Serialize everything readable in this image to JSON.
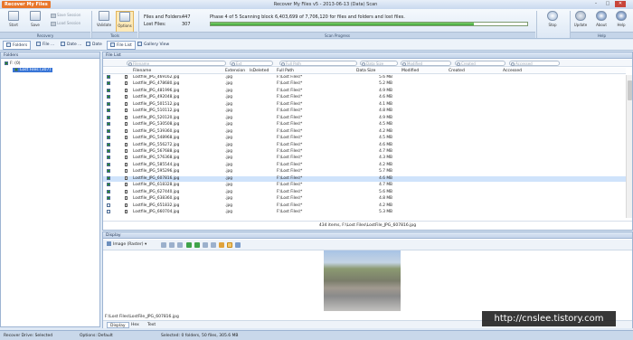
{
  "app": {
    "badge": "Recover My Files",
    "title": "Recover My Files v5 - 2013-06-13 (Data) Scan Results"
  },
  "window": {
    "minimize": "–",
    "maximize": "□",
    "close": "✕"
  },
  "ribbon": {
    "start": "Start",
    "save": "Save",
    "save_session": "Save Session",
    "load_session": "Load Session",
    "validate": "Validate",
    "options": "Options",
    "group_recovery": "Recovery",
    "group_tools": "Tools",
    "group_scan": "Scan Progress",
    "group_help": "Help",
    "files_folders_label": "Files and Folders:",
    "files_folders_value": "447",
    "lost_files_label": "Lost Files:",
    "lost_files_value": "307",
    "phase_text": "Phase 4 of 5 Scanning block 6,403,699 of 7,706,120 for files and folders and lost files.",
    "progress": 0.83,
    "stop": "Stop",
    "update": "Update",
    "about": "About",
    "help": "Help"
  },
  "viewtabs": [
    "Folders",
    "File ...",
    "Date ...",
    "Date",
    "File List",
    "Gallery View"
  ],
  "folders": {
    "header": "Folders",
    "root": "F: (0)",
    "child": "Lost Files (307)"
  },
  "filelist": {
    "header": "File List",
    "filters": [
      "Filename",
      "Ext",
      "Full Path",
      "Data Size",
      "Modified",
      "Created",
      "Accessed"
    ],
    "columns": [
      "Filename",
      "Extension",
      "IsDeleted",
      "Full Path",
      "Data Size",
      "Modified",
      "Created",
      "Accessed"
    ],
    "rows": [
      {
        "name": "Lostfile_JPG_469162.jpg",
        "ext": ".jpg",
        "path": "F:\\Lost Files\\*",
        "size": "5.6 MB",
        "checked": true
      },
      {
        "name": "Lostfile_JPG_478680.jpg",
        "ext": ".jpg",
        "path": "F:\\Lost Files\\*",
        "size": "5.2 MB",
        "checked": true
      },
      {
        "name": "Lostfile_JPG_481996.jpg",
        "ext": ".jpg",
        "path": "F:\\Lost Files\\*",
        "size": "4.9 MB",
        "checked": true
      },
      {
        "name": "Lostfile_JPG_492048.jpg",
        "ext": ".jpg",
        "path": "F:\\Lost Files\\*",
        "size": "4.6 MB",
        "checked": true
      },
      {
        "name": "Lostfile_JPG_501512.jpg",
        "ext": ".jpg",
        "path": "F:\\Lost Files\\*",
        "size": "4.1 MB",
        "checked": true
      },
      {
        "name": "Lostfile_JPG_510112.jpg",
        "ext": ".jpg",
        "path": "F:\\Lost Files\\*",
        "size": "4.8 MB",
        "checked": true
      },
      {
        "name": "Lostfile_JPG_520120.jpg",
        "ext": ".jpg",
        "path": "F:\\Lost Files\\*",
        "size": "4.9 MB",
        "checked": true
      },
      {
        "name": "Lostfile_JPG_530508.jpg",
        "ext": ".jpg",
        "path": "F:\\Lost Files\\*",
        "size": "4.5 MB",
        "checked": true
      },
      {
        "name": "Lostfile_JPG_539360.jpg",
        "ext": ".jpg",
        "path": "F:\\Lost Files\\*",
        "size": "4.2 MB",
        "checked": true
      },
      {
        "name": "Lostfile_JPG_548968.jpg",
        "ext": ".jpg",
        "path": "F:\\Lost Files\\*",
        "size": "4.5 MB",
        "checked": true
      },
      {
        "name": "Lostfile_JPG_556272.jpg",
        "ext": ".jpg",
        "path": "F:\\Lost Files\\*",
        "size": "4.6 MB",
        "checked": true
      },
      {
        "name": "Lostfile_JPG_567688.jpg",
        "ext": ".jpg",
        "path": "F:\\Lost Files\\*",
        "size": "4.7 MB",
        "checked": true
      },
      {
        "name": "Lostfile_JPG_576368.jpg",
        "ext": ".jpg",
        "path": "F:\\Lost Files\\*",
        "size": "4.3 MB",
        "checked": true
      },
      {
        "name": "Lostfile_JPG_585544.jpg",
        "ext": ".jpg",
        "path": "F:\\Lost Files\\*",
        "size": "4.2 MB",
        "checked": true
      },
      {
        "name": "Lostfile_JPG_595296.jpg",
        "ext": ".jpg",
        "path": "F:\\Lost Files\\*",
        "size": "5.7 MB",
        "checked": true
      },
      {
        "name": "Lostfile_JPG_607816.jpg",
        "ext": ".jpg",
        "path": "F:\\Lost Files\\*",
        "size": "4.6 MB",
        "checked": true,
        "selected": true
      },
      {
        "name": "Lostfile_JPG_618328.jpg",
        "ext": ".jpg",
        "path": "F:\\Lost Files\\*",
        "size": "4.7 MB",
        "checked": true
      },
      {
        "name": "Lostfile_JPG_627440.jpg",
        "ext": ".jpg",
        "path": "F:\\Lost Files\\*",
        "size": "5.6 MB",
        "checked": true
      },
      {
        "name": "Lostfile_JPG_638360.jpg",
        "ext": ".jpg",
        "path": "F:\\Lost Files\\*",
        "size": "4.8 MB",
        "checked": true
      },
      {
        "name": "Lostfile_JPG_651832.jpg",
        "ext": ".jpg",
        "path": "F:\\Lost Files\\*",
        "size": "4.2 MB",
        "checked": false
      },
      {
        "name": "Lostfile_JPG_660704.jpg",
        "ext": ".jpg",
        "path": "F:\\Lost Files\\*",
        "size": "5.3 MB",
        "checked": false
      }
    ],
    "status": "434 items, F:\\Lost Files\\LostFile_JPG_607816.jpg"
  },
  "display": {
    "header": "Display",
    "mode": "Image (Raster)",
    "path": "F:\\Lost Files\\LostFile_JPG_607816.jpg",
    "tabs": [
      "Display",
      "Hex",
      "Text"
    ]
  },
  "statusbar": {
    "drive": "Recover Drive: Selected",
    "options": "Options: Default",
    "selection": "Selected: 0 folders, 50 files, 305.6 MB"
  },
  "watermark": "http://cnslee.tistory.com",
  "colors": {
    "accent": "#e8762b",
    "progress": "#3ea53a",
    "selection": "#3875d7"
  }
}
